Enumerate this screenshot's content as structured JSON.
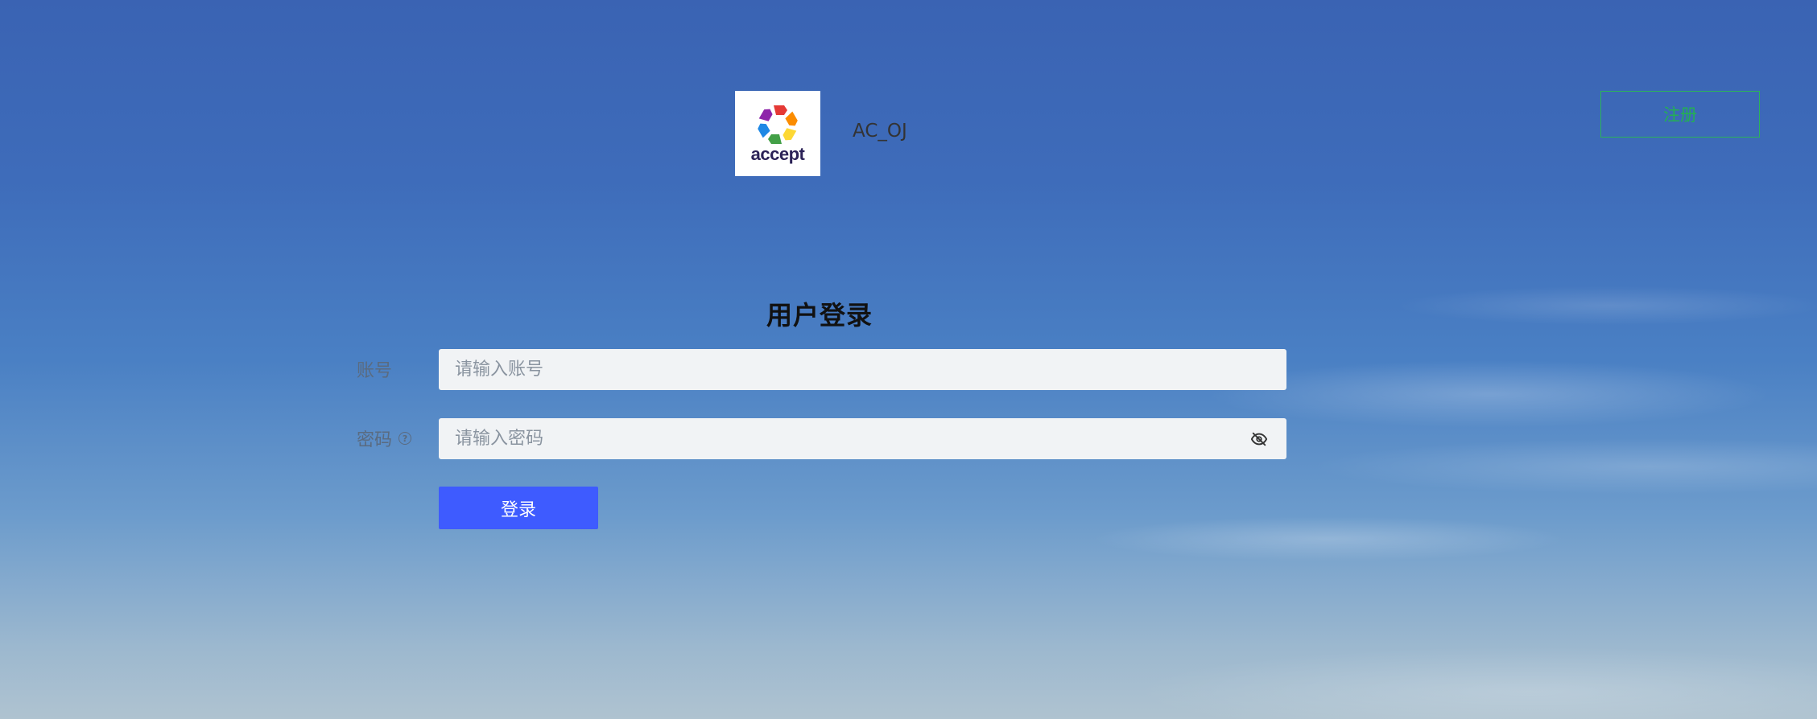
{
  "header": {
    "logo_text": "accept",
    "site_name": "AC_OJ",
    "register_label": "注册"
  },
  "login": {
    "title": "用户登录",
    "account_label": "账号",
    "account_placeholder": "请输入账号",
    "account_value": "",
    "password_label": "密码",
    "password_placeholder": "请输入密码",
    "password_value": "",
    "submit_label": "登录"
  },
  "colors": {
    "submit_button": "#3e5bff",
    "register_accent": "#23b053",
    "input_background": "#f1f3f5"
  },
  "icons": {
    "help": "question-circle-icon",
    "password_toggle": "eye-slash-icon"
  }
}
